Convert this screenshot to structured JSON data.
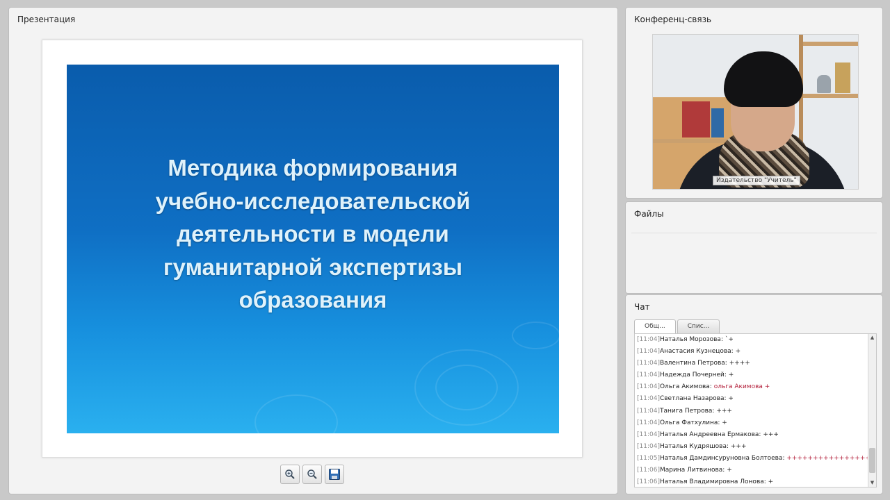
{
  "presentation": {
    "title": "Презентация",
    "slide_title": "Методика формирования\nучебно-исследовательской\nдеятельности в модели\nгуманитарной экспертизы\nобразования"
  },
  "conference": {
    "title": "Конференц-связь",
    "video_caption": "Издательство \"Учитель\""
  },
  "files": {
    "title": "Файлы"
  },
  "chat": {
    "title": "Чат",
    "tabs": [
      {
        "label": "Общ..."
      },
      {
        "label": "Спис..."
      }
    ],
    "messages": [
      {
        "time": "[11:04]",
        "name": "Наталья Морозова:",
        "text": "`+",
        "red": false
      },
      {
        "time": "[11:04]",
        "name": "Анастасия Кузнецова:",
        "text": "+",
        "red": false
      },
      {
        "time": "[11:04]",
        "name": "Валентина Петрова:",
        "text": "++++",
        "red": false
      },
      {
        "time": "[11:04]",
        "name": "Надежда Почерней:",
        "text": "+",
        "red": false
      },
      {
        "time": "[11:04]",
        "name": "Ольга Акимова:",
        "text": "ольга Акимова +",
        "red": true
      },
      {
        "time": "[11:04]",
        "name": "Светлана Назарова:",
        "text": "+",
        "red": false
      },
      {
        "time": "[11:04]",
        "name": "Танига Петрова:",
        "text": "+++",
        "red": false
      },
      {
        "time": "[11:04]",
        "name": "Ольга Фатхулина:",
        "text": "+",
        "red": false
      },
      {
        "time": "[11:04]",
        "name": "Наталья Андреевна Ермакова:",
        "text": "+++",
        "red": false
      },
      {
        "time": "[11:04]",
        "name": "Наталья Кудряшова:",
        "text": "+++",
        "red": false
      },
      {
        "time": "[11:05]",
        "name": "Наталья Дамдинсуруновна Болтоева:",
        "text": "++++++++++++++++++",
        "red": true
      },
      {
        "time": "[11:06]",
        "name": "Марина Литвинова:",
        "text": "+",
        "red": false
      },
      {
        "time": "[11:06]",
        "name": "Наталья Владимировна Лонова:",
        "text": "+",
        "red": false
      }
    ]
  },
  "colors": {
    "slide_top": "#0a5cac",
    "slide_bottom": "#2ab0ef",
    "slide_text": "#dff2fb",
    "chat_highlight": "#b3203b"
  },
  "icons": [
    "zoom-in-icon",
    "zoom-out-icon",
    "save-icon",
    "scroll-up-icon",
    "scroll-down-icon"
  ]
}
